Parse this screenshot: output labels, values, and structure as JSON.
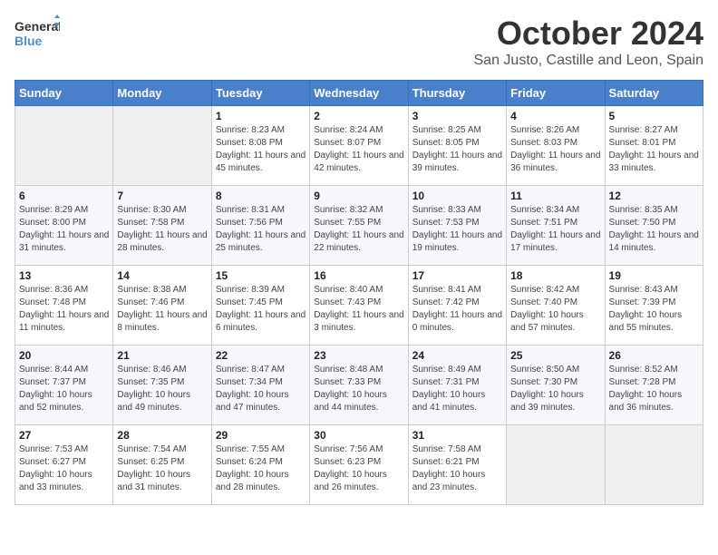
{
  "header": {
    "logo": {
      "general": "General",
      "blue": "Blue"
    },
    "title": "October 2024",
    "location": "San Justo, Castille and Leon, Spain"
  },
  "days_of_week": [
    "Sunday",
    "Monday",
    "Tuesday",
    "Wednesday",
    "Thursday",
    "Friday",
    "Saturday"
  ],
  "weeks": [
    {
      "days": [
        {
          "num": "",
          "detail": ""
        },
        {
          "num": "",
          "detail": ""
        },
        {
          "num": "1",
          "detail": "Sunrise: 8:23 AM\nSunset: 8:08 PM\nDaylight: 11 hours and 45 minutes."
        },
        {
          "num": "2",
          "detail": "Sunrise: 8:24 AM\nSunset: 8:07 PM\nDaylight: 11 hours and 42 minutes."
        },
        {
          "num": "3",
          "detail": "Sunrise: 8:25 AM\nSunset: 8:05 PM\nDaylight: 11 hours and 39 minutes."
        },
        {
          "num": "4",
          "detail": "Sunrise: 8:26 AM\nSunset: 8:03 PM\nDaylight: 11 hours and 36 minutes."
        },
        {
          "num": "5",
          "detail": "Sunrise: 8:27 AM\nSunset: 8:01 PM\nDaylight: 11 hours and 33 minutes."
        }
      ]
    },
    {
      "days": [
        {
          "num": "6",
          "detail": "Sunrise: 8:29 AM\nSunset: 8:00 PM\nDaylight: 11 hours and 31 minutes."
        },
        {
          "num": "7",
          "detail": "Sunrise: 8:30 AM\nSunset: 7:58 PM\nDaylight: 11 hours and 28 minutes."
        },
        {
          "num": "8",
          "detail": "Sunrise: 8:31 AM\nSunset: 7:56 PM\nDaylight: 11 hours and 25 minutes."
        },
        {
          "num": "9",
          "detail": "Sunrise: 8:32 AM\nSunset: 7:55 PM\nDaylight: 11 hours and 22 minutes."
        },
        {
          "num": "10",
          "detail": "Sunrise: 8:33 AM\nSunset: 7:53 PM\nDaylight: 11 hours and 19 minutes."
        },
        {
          "num": "11",
          "detail": "Sunrise: 8:34 AM\nSunset: 7:51 PM\nDaylight: 11 hours and 17 minutes."
        },
        {
          "num": "12",
          "detail": "Sunrise: 8:35 AM\nSunset: 7:50 PM\nDaylight: 11 hours and 14 minutes."
        }
      ]
    },
    {
      "days": [
        {
          "num": "13",
          "detail": "Sunrise: 8:36 AM\nSunset: 7:48 PM\nDaylight: 11 hours and 11 minutes."
        },
        {
          "num": "14",
          "detail": "Sunrise: 8:38 AM\nSunset: 7:46 PM\nDaylight: 11 hours and 8 minutes."
        },
        {
          "num": "15",
          "detail": "Sunrise: 8:39 AM\nSunset: 7:45 PM\nDaylight: 11 hours and 6 minutes."
        },
        {
          "num": "16",
          "detail": "Sunrise: 8:40 AM\nSunset: 7:43 PM\nDaylight: 11 hours and 3 minutes."
        },
        {
          "num": "17",
          "detail": "Sunrise: 8:41 AM\nSunset: 7:42 PM\nDaylight: 11 hours and 0 minutes."
        },
        {
          "num": "18",
          "detail": "Sunrise: 8:42 AM\nSunset: 7:40 PM\nDaylight: 10 hours and 57 minutes."
        },
        {
          "num": "19",
          "detail": "Sunrise: 8:43 AM\nSunset: 7:39 PM\nDaylight: 10 hours and 55 minutes."
        }
      ]
    },
    {
      "days": [
        {
          "num": "20",
          "detail": "Sunrise: 8:44 AM\nSunset: 7:37 PM\nDaylight: 10 hours and 52 minutes."
        },
        {
          "num": "21",
          "detail": "Sunrise: 8:46 AM\nSunset: 7:35 PM\nDaylight: 10 hours and 49 minutes."
        },
        {
          "num": "22",
          "detail": "Sunrise: 8:47 AM\nSunset: 7:34 PM\nDaylight: 10 hours and 47 minutes."
        },
        {
          "num": "23",
          "detail": "Sunrise: 8:48 AM\nSunset: 7:33 PM\nDaylight: 10 hours and 44 minutes."
        },
        {
          "num": "24",
          "detail": "Sunrise: 8:49 AM\nSunset: 7:31 PM\nDaylight: 10 hours and 41 minutes."
        },
        {
          "num": "25",
          "detail": "Sunrise: 8:50 AM\nSunset: 7:30 PM\nDaylight: 10 hours and 39 minutes."
        },
        {
          "num": "26",
          "detail": "Sunrise: 8:52 AM\nSunset: 7:28 PM\nDaylight: 10 hours and 36 minutes."
        }
      ]
    },
    {
      "days": [
        {
          "num": "27",
          "detail": "Sunrise: 7:53 AM\nSunset: 6:27 PM\nDaylight: 10 hours and 33 minutes."
        },
        {
          "num": "28",
          "detail": "Sunrise: 7:54 AM\nSunset: 6:25 PM\nDaylight: 10 hours and 31 minutes."
        },
        {
          "num": "29",
          "detail": "Sunrise: 7:55 AM\nSunset: 6:24 PM\nDaylight: 10 hours and 28 minutes."
        },
        {
          "num": "30",
          "detail": "Sunrise: 7:56 AM\nSunset: 6:23 PM\nDaylight: 10 hours and 26 minutes."
        },
        {
          "num": "31",
          "detail": "Sunrise: 7:58 AM\nSunset: 6:21 PM\nDaylight: 10 hours and 23 minutes."
        },
        {
          "num": "",
          "detail": ""
        },
        {
          "num": "",
          "detail": ""
        }
      ]
    }
  ]
}
